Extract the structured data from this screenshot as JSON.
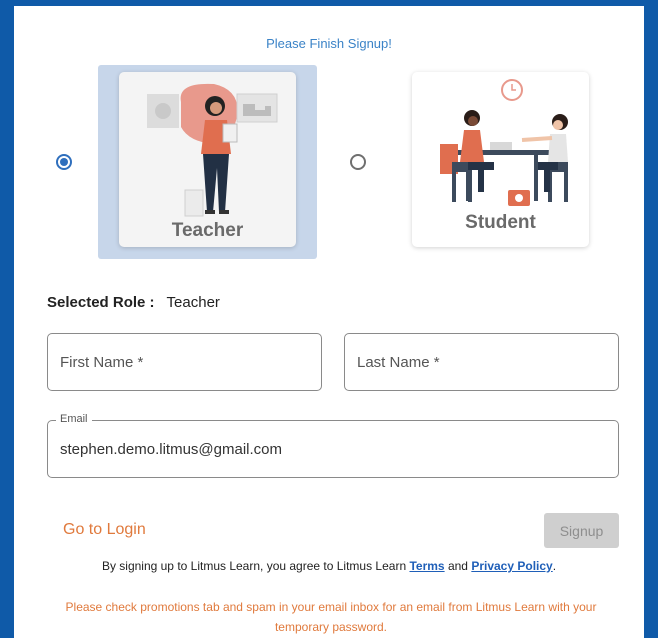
{
  "header": {
    "title": "Please Finish Signup!"
  },
  "roles": [
    {
      "label": "Teacher",
      "selected": true
    },
    {
      "label": "Student",
      "selected": false
    }
  ],
  "selected_role": {
    "label": "Selected Role :",
    "value": "Teacher"
  },
  "form": {
    "first_name_placeholder": "First Name *",
    "last_name_placeholder": "Last Name *",
    "email_label": "Email",
    "email_value": "stephen.demo.litmus@gmail.com"
  },
  "actions": {
    "login_label": "Go to Login",
    "signup_label": "Signup"
  },
  "agreement": {
    "prefix": "By signing up to Litmus Learn, you agree to Litmus Learn",
    "terms_label": "Terms",
    "and": "and",
    "privacy_label": "Privacy Policy",
    "suffix": "."
  },
  "notice": "Please check promotions tab and spam in your email inbox for an email from Litmus Learn with your temporary password.",
  "colors": {
    "frame": "#0f5aa8",
    "accent": "#e07a3d",
    "link": "#1f5fb8",
    "selected_bg": "#c7d6ea"
  }
}
